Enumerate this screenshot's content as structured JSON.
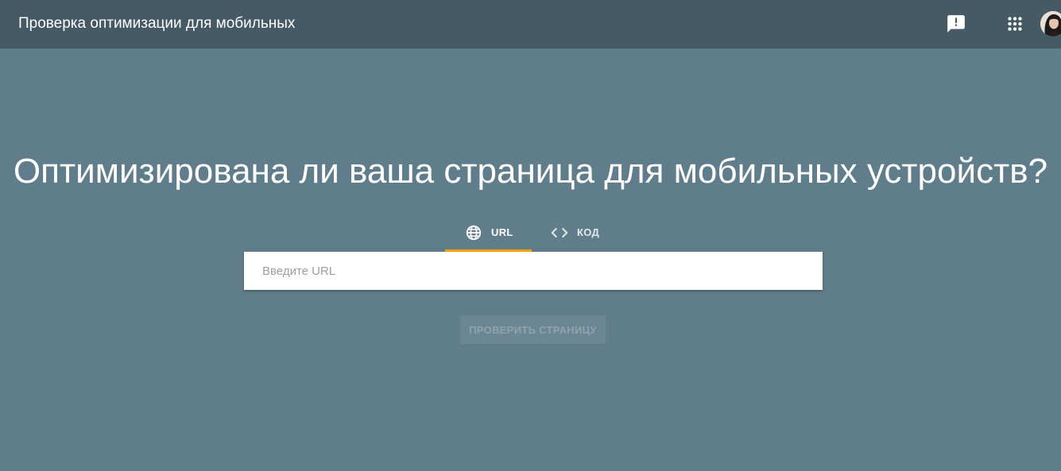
{
  "header": {
    "title": "Проверка оптимизации для мобильных",
    "feedback_icon": "feedback-icon",
    "apps_icon": "apps-grid-icon",
    "avatar_icon": "user-avatar"
  },
  "main": {
    "headline": "Оптимизирована ли ваша страница для мобильных устройств?",
    "tabs": [
      {
        "label": "URL",
        "icon": "globe-icon",
        "selected": true
      },
      {
        "label": "КОД",
        "icon": "code-icon",
        "selected": false
      }
    ],
    "url_input": {
      "placeholder": "Введите URL",
      "value": ""
    },
    "check_button": {
      "label": "ПРОВЕРИТЬ СТРАНИЦУ",
      "disabled": true
    }
  },
  "colors": {
    "background": "#607d8b",
    "topbar": "#455a64",
    "tab_indicator": "#f4a300",
    "input_background": "#ffffff",
    "button_disabled": "#6c8794"
  }
}
